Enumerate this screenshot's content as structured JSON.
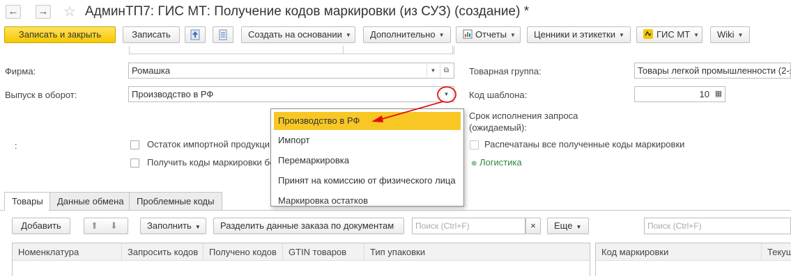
{
  "title": "АдминТП7: ГИС МТ: Получение кодов маркировки (из СУЗ) (создание) *",
  "nav": {
    "back": "←",
    "forward": "→",
    "star": "☆"
  },
  "toolbar": {
    "save_close": "Записать и закрыть",
    "save": "Записать",
    "create_based": "Создать на основании",
    "more": "Дополнительно",
    "reports": "Отчеты",
    "prices": "Ценники и этикетки",
    "gis": "ГИС МТ",
    "wiki": "Wiki"
  },
  "form": {
    "firm_label": "Фирма:",
    "firm_value": "Ромашка",
    "release_label": "Выпуск в оборот:",
    "release_value": "Производство в РФ",
    "group_label": "Товарная группа:",
    "group_value": "Товары легкой промышленности (2-я",
    "template_label": "Код шаблона:",
    "template_value": "10",
    "deadline_label_1": "Срок исполнения запроса",
    "deadline_label_2": "(ожидаемый):",
    "colon_label": ":",
    "chk_import": "Остаток импортной продукци",
    "chk_get_codes": "Получить коды маркировки бе",
    "chk_printed": "Распечатаны все полученные коды маркировки",
    "logistics": "Логистика"
  },
  "dropdown": {
    "items": [
      "Производство в РФ",
      "Импорт",
      "Перемаркировка",
      "Принят на комиссию от физического лица",
      "Маркировка остатков"
    ]
  },
  "tabs": [
    "Товары",
    "Данные обмена",
    "Проблемные коды"
  ],
  "table_toolbar": {
    "add": "Добавить",
    "fill": "Заполнить",
    "split": "Разделить данные заказа по документам",
    "search_placeholder": "Поиск (Ctrl+F)",
    "clear": "×",
    "more": "Еще",
    "search2_placeholder": "Поиск (Ctrl+F)"
  },
  "columns": [
    "Номенклатура",
    "Запросить кодов",
    "Получено кодов",
    "GTIN товаров",
    "Тип упаковки"
  ],
  "right_columns": [
    "Код маркировки",
    "Текущ"
  ],
  "colors": {
    "primary": "#f5c800",
    "selection": "#f8c723",
    "annotation": "#e01010",
    "link": "#2a8a3a"
  }
}
